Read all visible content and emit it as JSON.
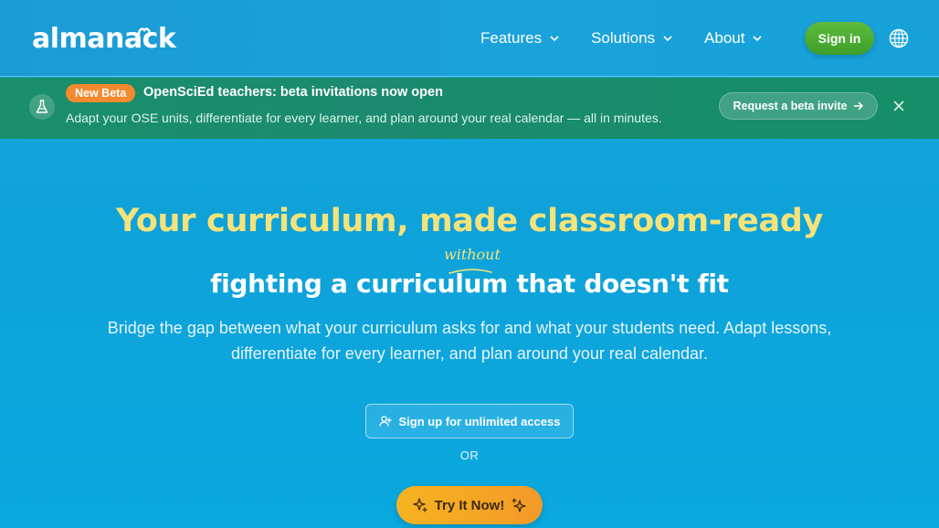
{
  "header": {
    "logo_text": "almanack",
    "nav": [
      {
        "label": "Features",
        "icon": "chevron-down-icon"
      },
      {
        "label": "Solutions",
        "icon": "chevron-down-icon"
      },
      {
        "label": "About",
        "icon": "chevron-down-icon"
      }
    ],
    "signin_label": "Sign in",
    "language_icon": "globe-icon"
  },
  "banner": {
    "icon": "flask-icon",
    "badge": "New Beta",
    "title": "OpenSciEd teachers: beta invitations now open",
    "subtitle": "Adapt your OSE units, differentiate for every learner, and plan around your real calendar — all in minutes.",
    "cta_label": "Request a beta invite",
    "cta_icon": "arrow-right-icon",
    "close_icon": "close-icon"
  },
  "hero": {
    "title": "Your curriculum, made classroom-ready",
    "line2": "fighting a curriculum that doesn't fit",
    "annotation": "without",
    "description": "Bridge the gap between what your curriculum asks for and what your students need. Adapt lessons, differentiate for every learner, and plan around your real calendar.",
    "signup_label": "Sign up for unlimited access",
    "signup_icon": "user-plus-icon",
    "or_label": "OR",
    "try_label": "Try It Now!",
    "try_icon": "sparkles-icon"
  },
  "colors": {
    "background": "#0fa2d9",
    "banner": "#1a8f6a",
    "accent_yellow": "#f4e37a",
    "signin_green": "#4caf35",
    "beta_orange": "#f28a2e",
    "try_orange": "#f5a823"
  }
}
